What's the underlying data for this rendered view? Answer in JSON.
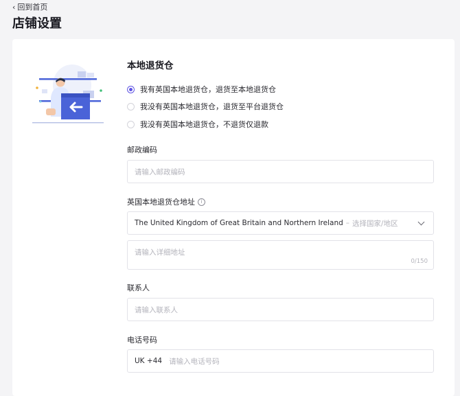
{
  "header": {
    "back_label": "回到首页",
    "title": "店铺设置"
  },
  "section": {
    "title": "本地退货仓",
    "options": [
      {
        "label": "我有英国本地退货仓，退货至本地退货仓",
        "selected": true
      },
      {
        "label": "我没有英国本地退货仓，退货至平台退货仓",
        "selected": false
      },
      {
        "label": "我没有英国本地退货仓，不退货仅退款",
        "selected": false
      }
    ]
  },
  "postcode": {
    "label": "邮政编码",
    "placeholder": "请输入邮政编码"
  },
  "address": {
    "label": "英国本地退货仓地址",
    "info_icon": "info-circle-icon",
    "country_value": "The United Kingdom of Great Britain and Northern Ireland",
    "separator": "–",
    "country_placeholder": "选择国家/地区",
    "detail_placeholder": "请输入详细地址",
    "char_count": "0/150"
  },
  "contact": {
    "label": "联系人",
    "placeholder": "请输入联系人"
  },
  "phone": {
    "label": "电话号码",
    "prefix": "UK +44",
    "placeholder": "请输入电话号码"
  },
  "colors": {
    "accent": "#5f54e3",
    "illustration_blue": "#4a63d8"
  }
}
